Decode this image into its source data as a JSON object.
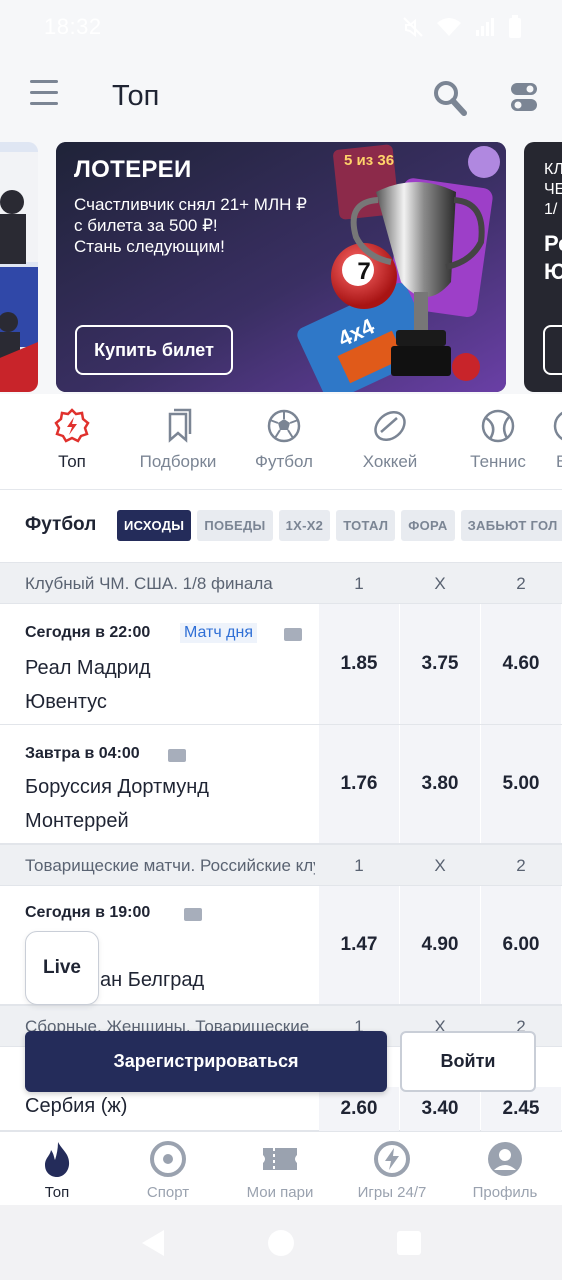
{
  "status": {
    "time": "18:32"
  },
  "header": {
    "title": "Топ"
  },
  "banner": {
    "title": "ЛОТЕРЕИ",
    "subtitle": "Счастливчик снял 21+ МЛН ₽\nс билета за 500 ₽!\nСтань следующим!",
    "button": "Купить билет",
    "art_labels": {
      "ticket": "5 из 36",
      "ball": "7",
      "card": "4x4"
    },
    "next_text": "КЛ\nЧЕ\n1/",
    "next_bold": "Ре\nЮ"
  },
  "sports": [
    {
      "label": "Топ",
      "icon": "flame-badge-icon",
      "active": true
    },
    {
      "label": "Подборки",
      "icon": "bookmarks-icon",
      "active": false
    },
    {
      "label": "Футбол",
      "icon": "soccer-ball-icon",
      "active": false
    },
    {
      "label": "Хоккей",
      "icon": "hockey-puck-icon",
      "active": false
    },
    {
      "label": "Теннис",
      "icon": "tennis-ball-icon",
      "active": false
    },
    {
      "label": "Б",
      "icon": "basketball-icon",
      "active": false
    }
  ],
  "filters": {
    "section": "Футбол",
    "chips": [
      "ИСХОДЫ",
      "ПОБЕДЫ",
      "1Х-Х2",
      "ТОТАЛ",
      "ФОРА",
      "ЗАБЬЮТ ГОЛ"
    ]
  },
  "leagues": [
    {
      "name": "Клубный ЧМ. США. 1/8 финала",
      "cols": [
        "1",
        "X",
        "2"
      ]
    },
    {
      "name": "Товарищеские матчи. Российские клубы",
      "cols": [
        "1",
        "X",
        "2"
      ]
    },
    {
      "name": "Сборные. Женщины. Товарищеские матчи",
      "cols": [
        "1",
        "X",
        "2"
      ]
    }
  ],
  "matches": [
    {
      "time": "Сегодня в 22:00",
      "badge": "Матч дня",
      "team1": "Реал Мадрид",
      "team2": "Ювентус",
      "odds": [
        "1.85",
        "3.75",
        "4.60"
      ]
    },
    {
      "time": "Завтра в 04:00",
      "team1": "Боруссия Дортмунд",
      "team2": "Монтеррей",
      "odds": [
        "1.76",
        "3.80",
        "5.00"
      ]
    },
    {
      "time": "Сегодня в 19:00",
      "team2": "ан Белград",
      "odds": [
        "1.47",
        "4.90",
        "6.00"
      ]
    },
    {
      "team1": "Сербия (ж)",
      "odds": [
        "2.60",
        "3.40",
        "2.45"
      ]
    }
  ],
  "actions": {
    "live": "Live",
    "register": "Зарегистрироваться",
    "login": "Войти"
  },
  "bottom_nav": [
    {
      "label": "Топ",
      "icon": "flame-icon",
      "active": true
    },
    {
      "label": "Спорт",
      "icon": "target-icon",
      "active": false
    },
    {
      "label": "Мои пари",
      "icon": "ticket-icon",
      "active": false
    },
    {
      "label": "Игры 24/7",
      "icon": "lightning-icon",
      "active": false
    },
    {
      "label": "Профиль",
      "icon": "profile-icon",
      "active": false
    }
  ],
  "colors": {
    "primary": "#242c5a",
    "accent_red": "#e0312d",
    "link_blue": "#2f6fd6",
    "text": "#1f2433",
    "muted": "#7b8594"
  }
}
